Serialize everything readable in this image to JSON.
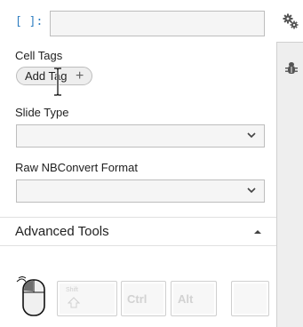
{
  "cell": {
    "prompt_label": "[ ]:",
    "prompt_value": ""
  },
  "cell_tags": {
    "title": "Cell Tags",
    "add_tag_label": "Add Tag",
    "add_icon": "plus-icon"
  },
  "slide_type": {
    "title": "Slide Type",
    "selected": ""
  },
  "raw_nbconvert": {
    "title": "Raw NBConvert Format",
    "selected": ""
  },
  "advanced_tools": {
    "title": "Advanced Tools",
    "collapse_icon": "caret-up-icon"
  },
  "keys": {
    "shift": "Shift",
    "ctrl": "Ctrl",
    "alt": "Alt",
    "blank": ""
  },
  "right_sidebar": {
    "tabs": [
      "gears-icon",
      "bug-icon"
    ]
  },
  "colors": {
    "prompt_blue": "#307fc1",
    "panel_bg": "#ffffff",
    "rail_bg": "#eeeeee",
    "border": "#bdbdbd"
  }
}
